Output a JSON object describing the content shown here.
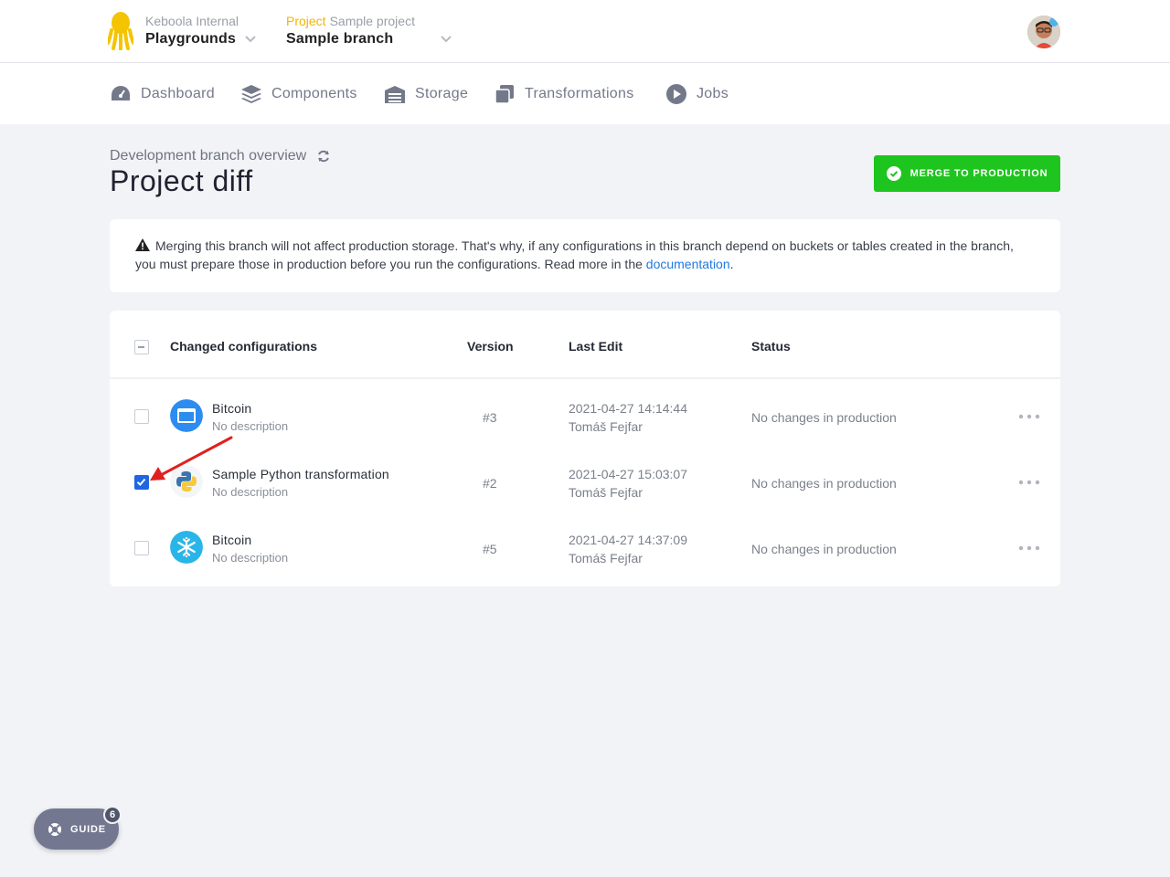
{
  "header": {
    "org_label": "Keboola Internal",
    "org_name": "Playgrounds",
    "project_label": "Project",
    "project_name": "Sample project",
    "branch_name": "Sample branch"
  },
  "nav": {
    "items": [
      {
        "label": "Dashboard",
        "icon": "dashboard-icon"
      },
      {
        "label": "Components",
        "icon": "layers-icon"
      },
      {
        "label": "Storage",
        "icon": "warehouse-icon"
      },
      {
        "label": "Transformations",
        "icon": "copy-icon"
      },
      {
        "label": "Jobs",
        "icon": "play-circle-icon"
      }
    ]
  },
  "page": {
    "subtitle": "Development branch overview",
    "title": "Project diff",
    "merge_label": "MERGE TO PRODUCTION"
  },
  "alert": {
    "text": "Merging this branch will not affect production storage. That's why, if any configurations in this branch depend on buckets or tables created in the branch, you must prepare those in production before you run the configurations. Read more in the ",
    "link": "documentation",
    "end": "."
  },
  "table": {
    "headers": {
      "config": "Changed configurations",
      "version": "Version",
      "last_edit": "Last Edit",
      "status": "Status"
    },
    "rows": [
      {
        "name": "Bitcoin",
        "description": "No description",
        "version": "#3",
        "date": "2021-04-27 14:14:44",
        "author": "Tomáš Fejfar",
        "status": "No changes in production",
        "checked": false,
        "icon": "browser-icon"
      },
      {
        "name": "Sample Python transformation",
        "description": "No description",
        "version": "#2",
        "date": "2021-04-27 15:03:07",
        "author": "Tomáš Fejfar",
        "status": "No changes in production",
        "checked": true,
        "icon": "python-icon"
      },
      {
        "name": "Bitcoin",
        "description": "No description",
        "version": "#5",
        "date": "2021-04-27 14:37:09",
        "author": "Tomáš Fejfar",
        "status": "No changes in production",
        "checked": false,
        "icon": "snowflake-icon"
      }
    ]
  },
  "guide": {
    "label": "GUIDE",
    "count": "6"
  },
  "colors": {
    "accent_green": "#1ec51e",
    "link_blue": "#1f79e0",
    "project_yellow": "#f5b400",
    "checkbox_blue": "#1f66e0"
  }
}
